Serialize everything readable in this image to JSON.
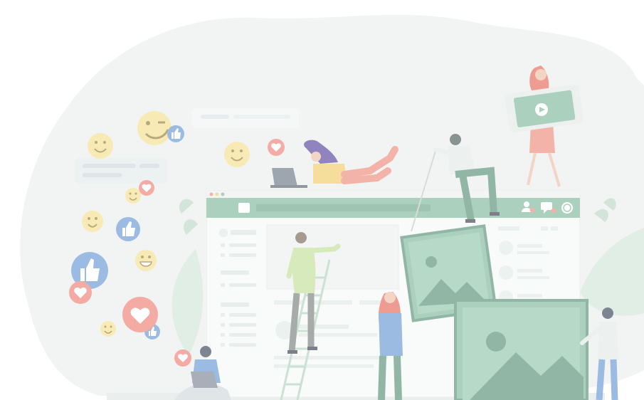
{
  "illustration": {
    "subject": "social-media-community",
    "colors": {
      "blob": "#eef1ef",
      "green": "#8fc1a9",
      "green_dark": "#6d9e89",
      "window": "#f7f9f8",
      "emoji": "#f6e39b",
      "like_blue": "#7aa4d8",
      "heart_red": "#ef8f86",
      "yellow_shirt": "#f2d37a",
      "coral": "#ef9a8c",
      "lime": "#c8e3a5",
      "hair_red": "#e97b6c",
      "gray": "#c9d1ce"
    },
    "icons": [
      "smile-icon",
      "wink-icon",
      "grin-icon",
      "thumbs-up-icon",
      "heart-icon",
      "image-icon",
      "user-icon",
      "chat-icon"
    ]
  }
}
